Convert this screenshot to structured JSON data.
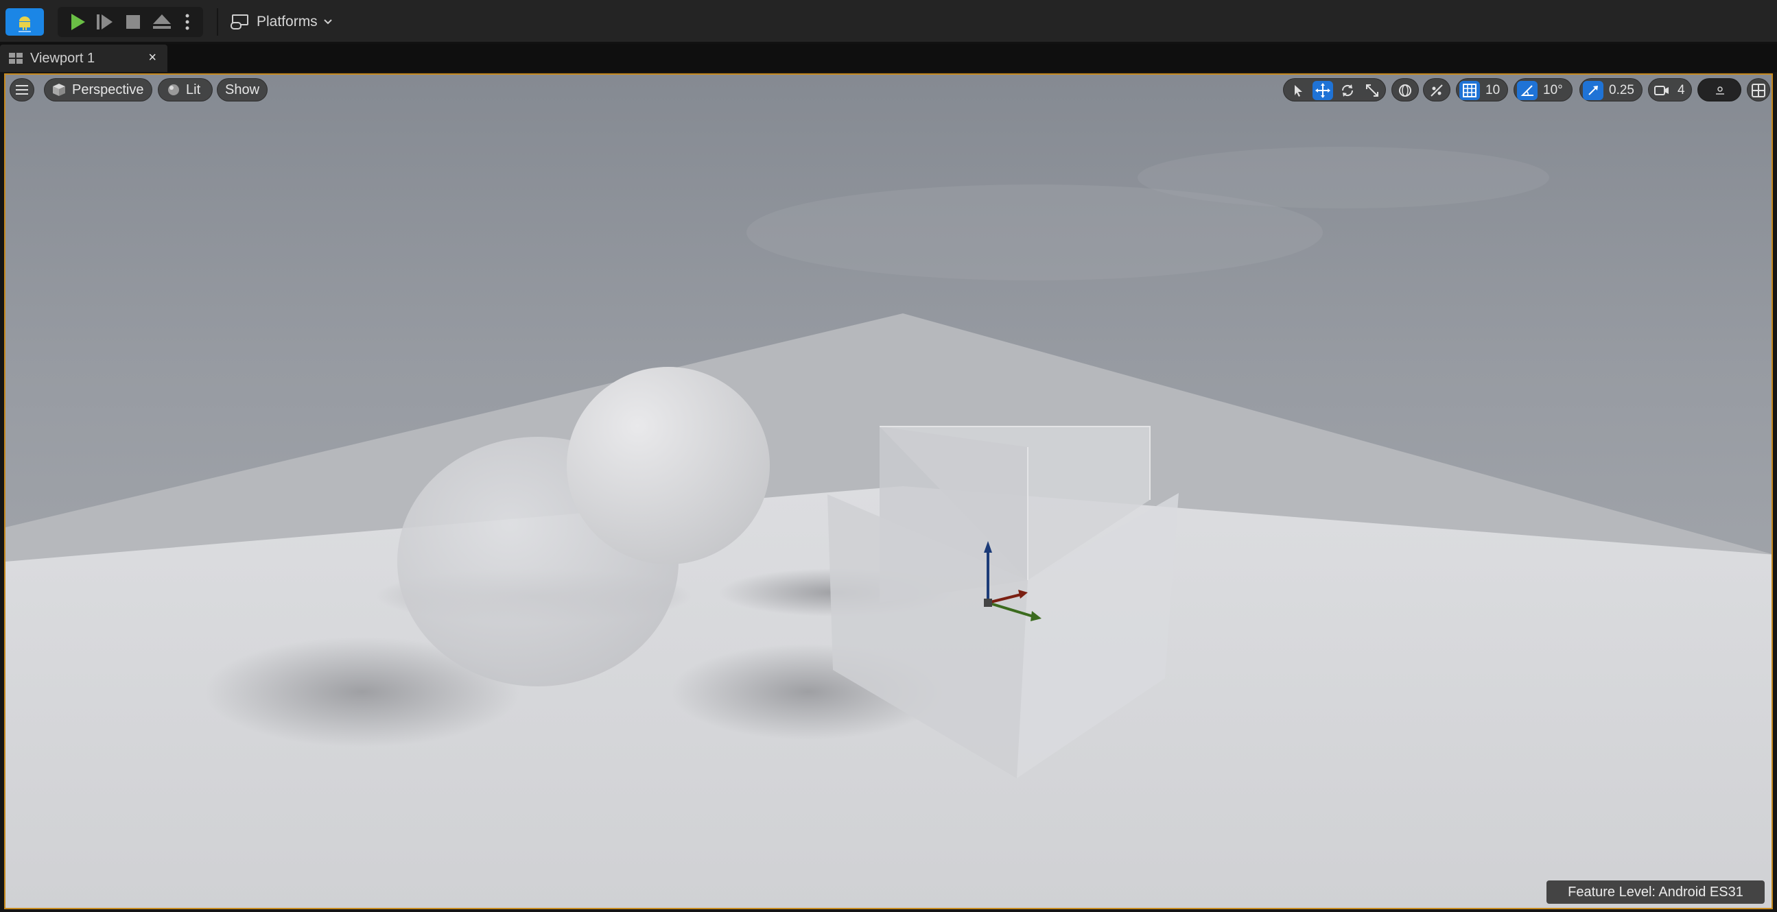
{
  "toolbar": {
    "mode_icon": "android-mode-icon",
    "play_icon": "play-icon",
    "advance_frame_icon": "advance-frame-icon",
    "stop_icon": "stop-icon",
    "eject_icon": "eject-icon",
    "more_icon": "vertical-dots-icon",
    "platforms_label": "Platforms"
  },
  "tab": {
    "label": "Viewport 1",
    "close": "×"
  },
  "viewport": {
    "menu_icon": "hamburger-icon",
    "perspective_label": "Perspective",
    "lit_label": "Lit",
    "show_label": "Show",
    "grid_snap_value": "10",
    "rotation_snap_value": "10°",
    "scale_snap_value": "0.25",
    "camera_speed_value": "4",
    "feature_level": "Feature Level:  Android ES31"
  },
  "colors": {
    "accent_blue": "#1f73d6",
    "play_green": "#6abf45",
    "viewport_border": "#c78a1e",
    "toolbar_bg": "#242424"
  }
}
